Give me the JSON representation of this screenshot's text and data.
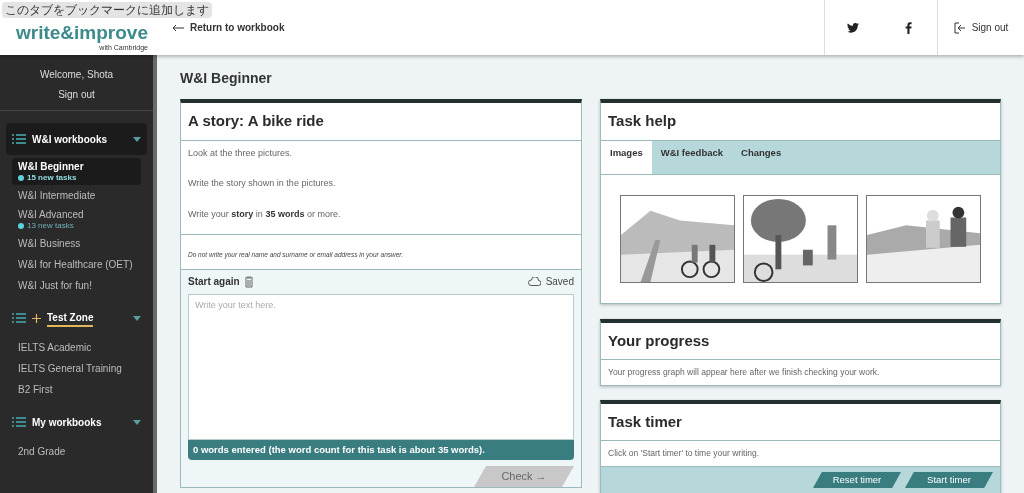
{
  "browser_tooltip": "このタブをブックマークに追加します",
  "header": {
    "logo": {
      "wordmark": "write&improve",
      "tagline": "with Cambridge"
    },
    "back_link": "Return to workbook",
    "sign_out": "Sign out"
  },
  "sidebar": {
    "welcome": "Welcome, Shota",
    "sign_out": "Sign out",
    "sections": [
      {
        "title": "W&I workbooks",
        "kind": "plain",
        "active": true,
        "expanded": true,
        "items": [
          {
            "label": "W&I Beginner",
            "badge": "15 new tasks",
            "selected": true
          },
          {
            "label": "W&I Intermediate",
            "selected": false
          },
          {
            "label": "W&I Advanced",
            "badge": "13 new tasks",
            "selected": false
          },
          {
            "label": "W&I Business",
            "selected": false
          },
          {
            "label": "W&I for Healthcare (OET)",
            "selected": false
          },
          {
            "label": "W&I Just for fun!",
            "selected": false
          }
        ]
      },
      {
        "title": "Test Zone",
        "kind": "featured",
        "active": false,
        "expanded": true,
        "items": [
          {
            "label": "IELTS Academic",
            "selected": false
          },
          {
            "label": "IELTS General Training",
            "selected": false
          },
          {
            "label": "B2 First",
            "selected": false
          }
        ]
      },
      {
        "title": "My workbooks",
        "kind": "plain",
        "active": false,
        "expanded": true,
        "items": [
          {
            "label": "2nd Grade",
            "selected": false
          }
        ]
      }
    ]
  },
  "page_title": "W&I Beginner",
  "task": {
    "title": "A story: A bike ride",
    "instructions": [
      "Look at the three pictures.",
      "Write the story shown in the pictures.",
      "Write your **story** in **35 words** or more."
    ],
    "note": "Do not write your real name and surname or email address in your answer.",
    "start_again": "Start again",
    "saved": "Saved",
    "placeholder": "Write your text here.",
    "word_count": "0 words entered (the word count for this task is about 35 words).",
    "check_button": {
      "label": "Check →",
      "disabled": true
    }
  },
  "task_help": {
    "title": "Task help",
    "tabs": [
      {
        "label": "Images",
        "selected": true
      },
      {
        "label": "W&I feedback",
        "selected": false
      },
      {
        "label": "Changes",
        "selected": false
      }
    ]
  },
  "progress": {
    "title": "Your progress",
    "text": "Your progress graph will appear here after we finish checking your work."
  },
  "timer": {
    "title": "Task timer",
    "text": "Click on 'Start timer' to time your writing.",
    "buttons": [
      "Reset timer",
      "Start timer"
    ]
  }
}
